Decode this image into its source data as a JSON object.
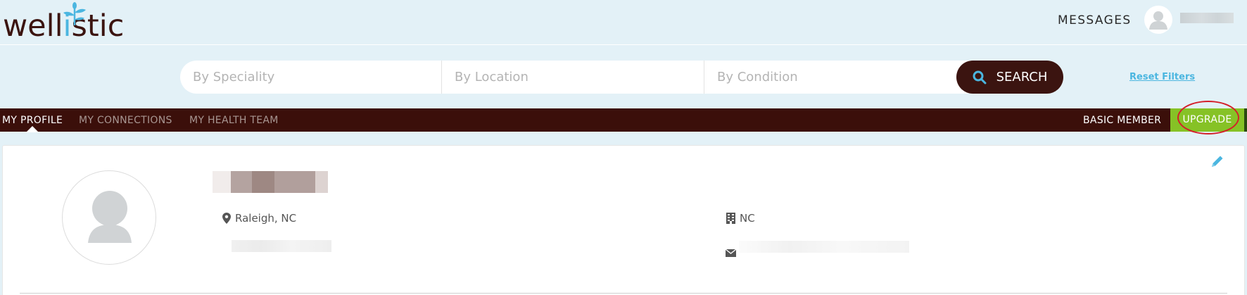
{
  "header": {
    "logo": {
      "part1": "well",
      "part2": "i",
      "part3": "stic"
    },
    "messages_label": "MESSAGES"
  },
  "search": {
    "speciality_placeholder": "By Speciality",
    "location_placeholder": "By Location",
    "condition_placeholder": "By Condition",
    "search_label": "SEARCH",
    "reset_label": "Reset Filters"
  },
  "nav": {
    "items": [
      {
        "label": "MY PROFILE",
        "active": true
      },
      {
        "label": "MY CONNECTIONS",
        "active": false
      },
      {
        "label": "MY HEALTH TEAM",
        "active": false
      }
    ],
    "member_label": "BASIC MEMBER",
    "upgrade_label": "UPGRADE"
  },
  "profile": {
    "location": "Raleigh, NC",
    "organization": "NC"
  },
  "colors": {
    "brand_dark": "#3b1410",
    "accent_blue": "#4bb6e0",
    "upgrade_green": "#86c226",
    "highlight_red": "#d41f2a"
  }
}
